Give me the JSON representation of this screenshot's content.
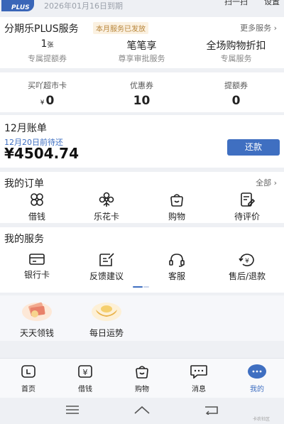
{
  "header": {
    "plus_badge": "PLUS",
    "expire_text": "2026年01月16日到期",
    "scan_label": "扫一扫",
    "settings_label": "设置"
  },
  "plus_service": {
    "title": "分期乐PLUS服务",
    "tag": "本月服务已发放",
    "more_link": "更多服务 ›",
    "columns": [
      {
        "value": "1",
        "unit": "张",
        "label": "专属提额券"
      },
      {
        "value": "笔笔享",
        "unit": "",
        "label": "尊享审批服务"
      },
      {
        "value": "全场购物折扣",
        "unit": "",
        "label": "专属服务"
      }
    ]
  },
  "assets": [
    {
      "label": "买吖超市卡",
      "prefix": "¥",
      "value": "0"
    },
    {
      "label": "优惠券",
      "prefix": "",
      "value": "10"
    },
    {
      "label": "提额券",
      "prefix": "",
      "value": "0"
    }
  ],
  "bill": {
    "title": "12月账单",
    "due": "12月20日前待还",
    "amount": "¥4504.74",
    "repay_button": "还款"
  },
  "orders": {
    "title": "我的订单",
    "all_link": "全部 ›",
    "items": [
      {
        "label": "借钱",
        "icon": "clover-icon"
      },
      {
        "label": "乐花卡",
        "icon": "flower-icon"
      },
      {
        "label": "购物",
        "icon": "bag-icon"
      },
      {
        "label": "待评价",
        "icon": "review-icon"
      }
    ]
  },
  "services": {
    "title": "我的服务",
    "items": [
      {
        "label": "银行卡",
        "icon": "card-icon"
      },
      {
        "label": "反馈建议",
        "icon": "feedback-icon"
      },
      {
        "label": "客服",
        "icon": "headset-icon"
      },
      {
        "label": "售后/退款",
        "icon": "refund-icon"
      }
    ]
  },
  "extras": [
    {
      "label": "天天领钱",
      "icon": "money-icon"
    },
    {
      "label": "每日运势",
      "icon": "ingot-icon"
    }
  ],
  "bottom_nav": [
    {
      "label": "首页",
      "icon": "home-icon"
    },
    {
      "label": "借钱",
      "icon": "yuan-icon"
    },
    {
      "label": "购物",
      "icon": "bag-icon"
    },
    {
      "label": "消息",
      "icon": "message-icon"
    },
    {
      "label": "我的",
      "icon": "me-icon"
    }
  ],
  "watermark": "卡农社区",
  "colors": {
    "accent": "#3f6fc1",
    "tag_bg": "#fbf1e1",
    "tag_text": "#b8863a",
    "background": "#eef0f4"
  }
}
